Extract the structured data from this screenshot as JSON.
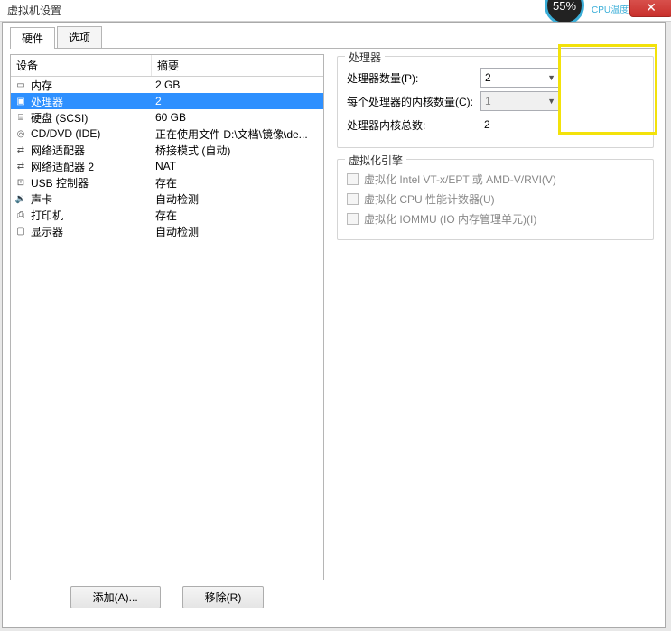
{
  "title": "虚拟机设置",
  "gauge": {
    "percent": "55%",
    "label": "CPU温度"
  },
  "tabs": {
    "hardware": "硬件",
    "options": "选项"
  },
  "columns": {
    "device": "设备",
    "summary": "摘要"
  },
  "devices": [
    {
      "icon": "▭",
      "name": "内存",
      "summary": "2 GB"
    },
    {
      "icon": "▣",
      "name": "处理器",
      "summary": "2"
    },
    {
      "icon": "⌸",
      "name": "硬盘 (SCSI)",
      "summary": "60 GB"
    },
    {
      "icon": "◎",
      "name": "CD/DVD (IDE)",
      "summary": "正在使用文件 D:\\文档\\镜像\\de..."
    },
    {
      "icon": "⇄",
      "name": "网络适配器",
      "summary": "桥接模式 (自动)"
    },
    {
      "icon": "⇄",
      "name": "网络适配器 2",
      "summary": "NAT"
    },
    {
      "icon": "⊡",
      "name": "USB 控制器",
      "summary": "存在"
    },
    {
      "icon": "🔉",
      "name": "声卡",
      "summary": "自动检测"
    },
    {
      "icon": "⎙",
      "name": "打印机",
      "summary": "存在"
    },
    {
      "icon": "▢",
      "name": "显示器",
      "summary": "自动检测"
    }
  ],
  "selectedIndex": 1,
  "buttons": {
    "add": "添加(A)...",
    "remove": "移除(R)"
  },
  "processorPanel": {
    "title": "处理器",
    "countLabel": "处理器数量(P):",
    "countValue": "2",
    "coresPerLabel": "每个处理器的内核数量(C):",
    "coresPerValue": "1",
    "totalLabel": "处理器内核总数:",
    "totalValue": "2"
  },
  "virtEngine": {
    "title": "虚拟化引擎",
    "opt1": "虚拟化 Intel VT-x/EPT 或 AMD-V/RVI(V)",
    "opt2": "虚拟化 CPU 性能计数器(U)",
    "opt3": "虚拟化 IOMMU (IO 内存管理单元)(I)"
  }
}
